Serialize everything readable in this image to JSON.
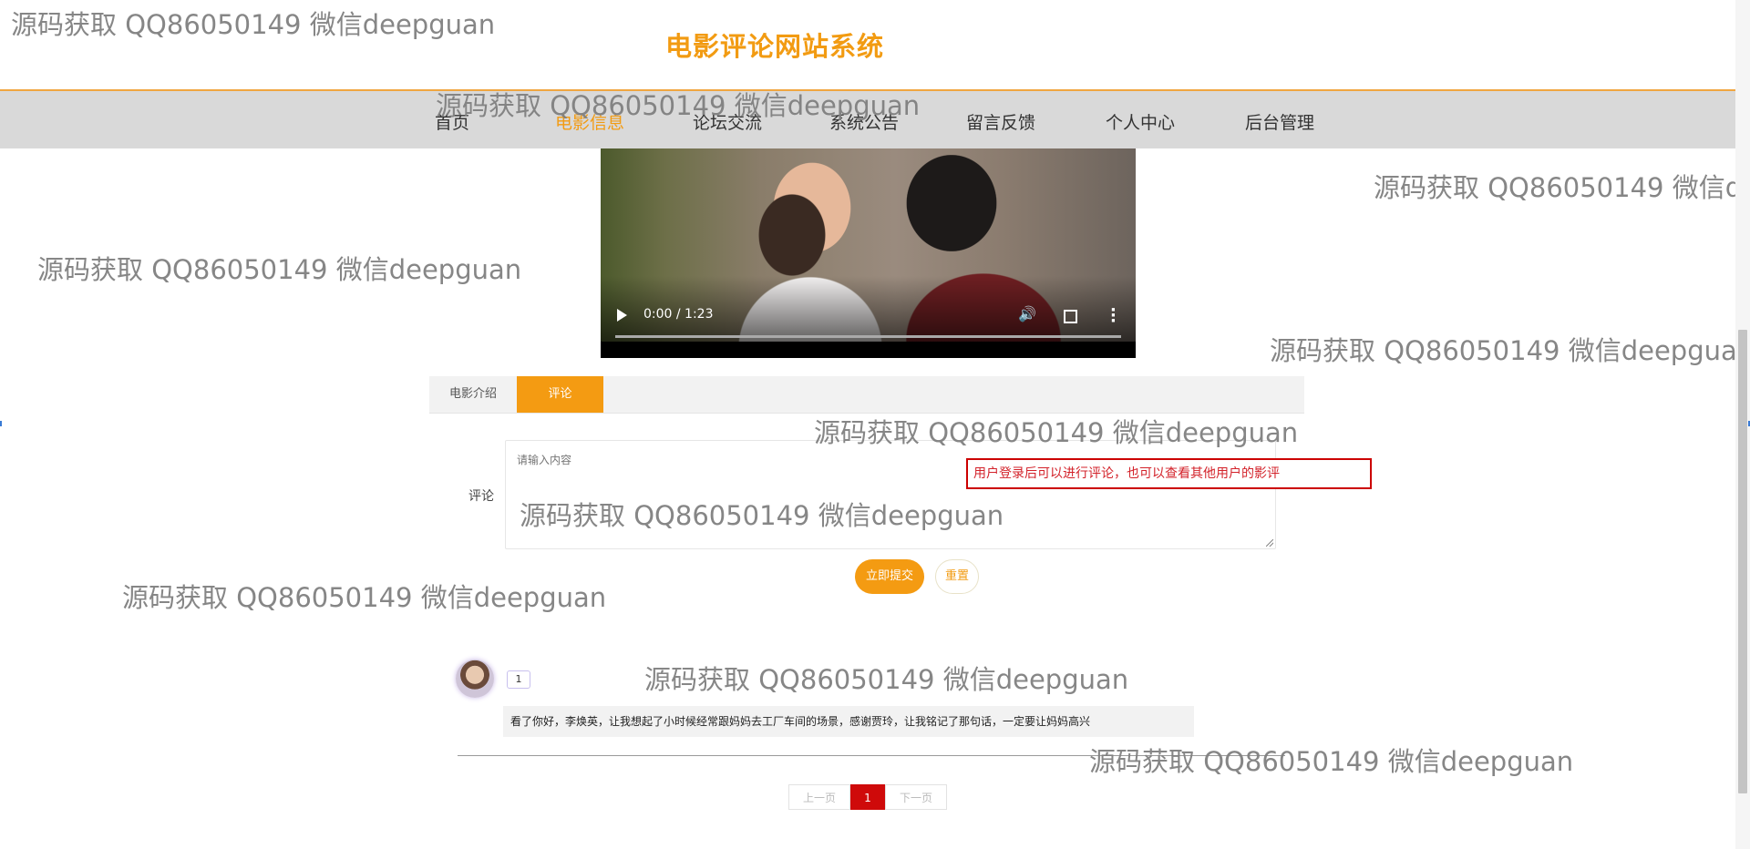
{
  "site": {
    "title": "电影评论网站系统"
  },
  "nav": [
    {
      "label": "首页",
      "active": false
    },
    {
      "label": "电影信息",
      "active": true
    },
    {
      "label": "论坛交流",
      "active": false
    },
    {
      "label": "系统公告",
      "active": false
    },
    {
      "label": "留言反馈",
      "active": false
    },
    {
      "label": "个人中心",
      "active": false
    },
    {
      "label": "后台管理",
      "active": false
    }
  ],
  "video": {
    "time": "0:00 / 1:23",
    "progress": 0
  },
  "tabs": [
    {
      "label": "电影介绍",
      "active": false
    },
    {
      "label": "评论",
      "active": true
    }
  ],
  "comment_form": {
    "label": "评论",
    "placeholder": "请输入内容",
    "value": "",
    "submit_label": "立即提交",
    "reset_label": "重置"
  },
  "annotation": "用户登录后可以进行评论，也可以查看其他用户的影评",
  "comments": [
    {
      "user": "1",
      "text": "看了你好，李焕英，让我想起了小时候经常跟妈妈去工厂车间的场景，感谢贾玲，让我铭记了那句话，一定要让妈妈高兴"
    }
  ],
  "pagination": {
    "prev": "上一页",
    "current": "1",
    "next": "下一页"
  },
  "watermark": "源码获取 QQ86050149 微信deepguan",
  "colors": {
    "accent": "#f49b12",
    "page_active": "#cf0a0a",
    "annotation": "#cc0000"
  }
}
